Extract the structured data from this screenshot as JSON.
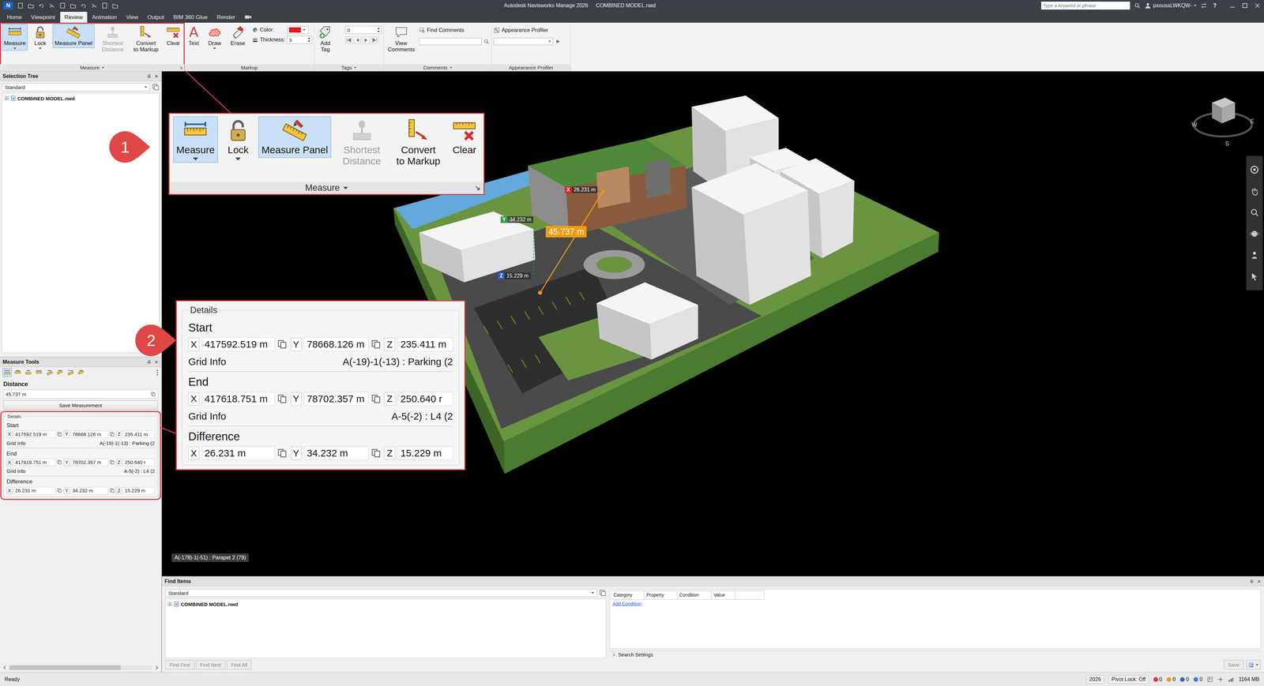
{
  "window": {
    "logo": "N",
    "title": "Autodesk Navisworks Manage 2026",
    "file": "COMBINED MODEL.nwd",
    "search_placeholder": "Type a keyword or phrase",
    "user": "psousaLWKQW-",
    "help": "?"
  },
  "menu_tabs": [
    {
      "label": "Home",
      "selected": false
    },
    {
      "label": "Viewpoint",
      "selected": false
    },
    {
      "label": "Review",
      "selected": true
    },
    {
      "label": "Animation",
      "selected": false
    },
    {
      "label": "View",
      "selected": false
    },
    {
      "label": "Output",
      "selected": false
    },
    {
      "label": "BIM 360 Glue",
      "selected": false
    },
    {
      "label": "Render",
      "selected": false
    }
  ],
  "ribbon": {
    "measure": {
      "title": "Measure",
      "annotated": true,
      "buttons": [
        {
          "label": "Measure",
          "selected": true,
          "disabled": false,
          "dropdown": true
        },
        {
          "label": "Lock",
          "selected": false,
          "disabled": false,
          "dropdown": true
        },
        {
          "label": "Measure Panel",
          "selected": true,
          "disabled": false,
          "dropdown": false
        },
        {
          "label": "Shortest Distance",
          "selected": false,
          "disabled": true,
          "dropdown": false
        },
        {
          "label": "Convert to Markup",
          "selected": false,
          "disabled": false,
          "dropdown": false
        },
        {
          "label": "Clear",
          "selected": false,
          "disabled": false,
          "dropdown": false
        }
      ]
    },
    "markup": {
      "title": "Markup",
      "text_tool": {
        "label": "Text",
        "glyph": "A"
      },
      "draw_tool": {
        "label": "Draw"
      },
      "erase_tool": {
        "label": "Erase"
      },
      "color_label": "Color:",
      "color": "#e01b1b",
      "thickness_label": "Thickness:",
      "thickness": "3"
    },
    "tags": {
      "title": "Tags",
      "add_label": "Add Tag",
      "tag_value": "0"
    },
    "comments": {
      "title": "Comments",
      "view_label": "View Comments",
      "find_label": "Find Comments"
    },
    "appearance": {
      "title": "Appearance Profiler",
      "label": "Appearance Profiler"
    }
  },
  "selection_tree": {
    "title": "Selection Tree",
    "mode": "Standard",
    "items": [
      {
        "label": "COMBINED MODEL.nwd",
        "expanded": false
      }
    ]
  },
  "measure_tools": {
    "title": "Measure Tools",
    "tools": [
      {
        "selected": true
      },
      {
        "selected": false
      },
      {
        "selected": false
      },
      {
        "selected": false
      },
      {
        "selected": false
      },
      {
        "selected": false
      },
      {
        "selected": false
      },
      {
        "selected": false
      }
    ],
    "distance_label": "Distance",
    "distance": "45.737 m",
    "save_label": "Save Measurement",
    "details": {
      "legend": "Details",
      "annotated": true,
      "sections": [
        {
          "title": "Start",
          "coords": [
            {
              "axis": "X",
              "value": "417592.519 m"
            },
            {
              "axis": "Y",
              "value": "78668.126 m"
            },
            {
              "axis": "Z",
              "value": "235.411 m"
            }
          ],
          "grid_label": "Grid Info",
          "grid_info": "A(-19)-1(-13) : Parking (2"
        },
        {
          "title": "End",
          "coords": [
            {
              "axis": "X",
              "value": "417618.751 m"
            },
            {
              "axis": "Y",
              "value": "78702.357 m"
            },
            {
              "axis": "Z",
              "value": "250.640 r"
            }
          ],
          "grid_label": "Grid Info",
          "grid_info": "A-5(-2) : L4 (2"
        },
        {
          "title": "Difference",
          "coords": [
            {
              "axis": "X",
              "value": "26.231 m"
            },
            {
              "axis": "Y",
              "value": "34.232 m"
            },
            {
              "axis": "Z",
              "value": "15.229 m"
            }
          ]
        }
      ]
    }
  },
  "viewport": {
    "labels": [
      {
        "axis": "X",
        "value": "26.231 m",
        "color": "#e02424"
      },
      {
        "axis": "Y",
        "value": "34.232 m",
        "color": "#2ea043"
      },
      {
        "axis": "Z",
        "value": "15.229 m",
        "color": "#1f5fd6"
      }
    ],
    "total": "45.737 m",
    "tooltip": "A(-178)-1(-51) : Parapet 2 (79)",
    "compass": [
      {
        "letter": "W"
      },
      {
        "letter": "E"
      },
      {
        "letter": "S"
      }
    ]
  },
  "callouts": [
    {
      "number": "1"
    },
    {
      "number": "2"
    }
  ],
  "find_items": {
    "title": "Find Items",
    "mode": "Standard",
    "items": [
      {
        "label": "COMBINED MODEL.nwd",
        "expanded": false
      }
    ],
    "columns": [
      "Category",
      "Property",
      "Condition",
      "Value"
    ],
    "add_condition": "Add Condition",
    "search_settings": "Search Settings",
    "search_settings_expanded": false,
    "buttons": [
      {
        "label": "Find First",
        "disabled": true
      },
      {
        "label": "Find Next",
        "disabled": true
      },
      {
        "label": "Find All",
        "disabled": true
      }
    ],
    "save": {
      "label": "Save",
      "disabled": true
    }
  },
  "status_bar": {
    "text": "Ready",
    "year": "2026",
    "pivot_lock": "Pivot Lock: Off",
    "indicators": [
      {
        "count": "0",
        "color": "#d9363e"
      },
      {
        "count": "0",
        "color": "#e0a800"
      },
      {
        "count": "0",
        "color": "#2b6cd4"
      },
      {
        "count": "0",
        "color": "#3a7bd5"
      }
    ],
    "memory": "1164 MB"
  }
}
